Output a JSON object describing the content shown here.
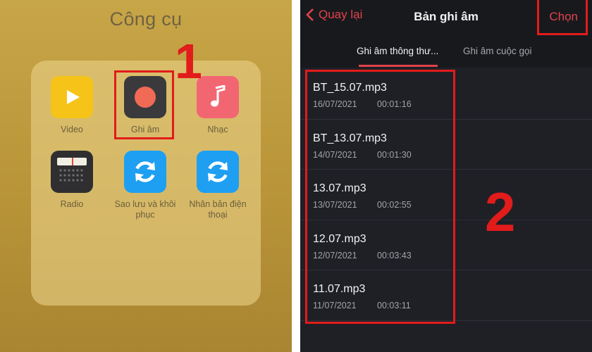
{
  "left_panel": {
    "folder_title": "Công cụ",
    "apps": [
      {
        "label": "Video",
        "icon": "play-icon"
      },
      {
        "label": "Ghi âm",
        "icon": "record-icon"
      },
      {
        "label": "Nhạc",
        "icon": "music-note-icon"
      },
      {
        "label": "Radio",
        "icon": "radio-icon"
      },
      {
        "label": "Sao lưu và khôi phục",
        "icon": "sync-icon"
      },
      {
        "label": "Nhân bản điện thoại",
        "icon": "sync-icon"
      }
    ],
    "step_label": "1"
  },
  "right_panel": {
    "back_label": "Quay lại",
    "title": "Bản ghi âm",
    "select_label": "Chọn",
    "tabs": [
      {
        "label": "Ghi âm thông thư...",
        "active": true
      },
      {
        "label": "Ghi âm cuộc gọi",
        "active": false
      }
    ],
    "recordings": [
      {
        "name": "BT_15.07.mp3",
        "date": "16/07/2021",
        "duration": "00:01:16"
      },
      {
        "name": "BT_13.07.mp3",
        "date": "14/07/2021",
        "duration": "00:01:30"
      },
      {
        "name": "13.07.mp3",
        "date": "13/07/2021",
        "duration": "00:02:55"
      },
      {
        "name": "12.07.mp3",
        "date": "12/07/2021",
        "duration": "00:03:43"
      },
      {
        "name": "11.07.mp3",
        "date": "11/07/2021",
        "duration": "00:03:11"
      }
    ],
    "step_label": "2"
  },
  "colors": {
    "highlight": "#e21b1b",
    "accent": "#e2434b",
    "dark_bg": "#1f2026",
    "folder_bg": "#c7a648"
  }
}
